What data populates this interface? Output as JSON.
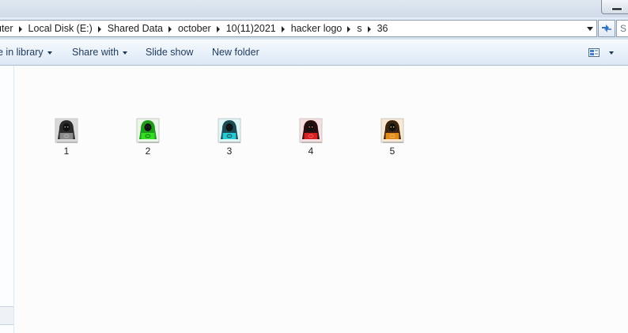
{
  "address": {
    "crumbs": [
      "uter",
      "Local Disk (E:)",
      "Shared Data",
      "october",
      "10(11)2021",
      "hacker logo",
      "s",
      "36"
    ],
    "search_placeholder": "S"
  },
  "toolbar": {
    "include_library": "e in library",
    "share_with": "Share with",
    "slide_show": "Slide show",
    "new_folder": "New folder"
  },
  "files": [
    {
      "name": "1",
      "icon": "hacker-logo-black",
      "bg": "#d9d9d9",
      "hood": "#2b2b2b",
      "laptop": "#8a8a8a",
      "accent": "#bdbdbd"
    },
    {
      "name": "2",
      "icon": "hacker-logo-green",
      "bg": "#eaf7e8",
      "hood": "#1f9a1a",
      "laptop": "#33dd22",
      "accent": "#0f5e0c"
    },
    {
      "name": "3",
      "icon": "hacker-logo-cyan",
      "bg": "#dff6f6",
      "hood": "#1a4c55",
      "laptop": "#27c9d3",
      "accent": "#0f2d33"
    },
    {
      "name": "4",
      "icon": "hacker-logo-red",
      "bg": "#f7dddd",
      "hood": "#2a0d0d",
      "laptop": "#d42020",
      "accent": "#ff6b6b"
    },
    {
      "name": "5",
      "icon": "hacker-logo-orange",
      "bg": "#f9e8cf",
      "hood": "#3a2410",
      "laptop": "#e08a1c",
      "accent": "#f6c069"
    }
  ],
  "colors": {
    "toolbar_text": "#1e395b",
    "border": "#8e9db0"
  }
}
